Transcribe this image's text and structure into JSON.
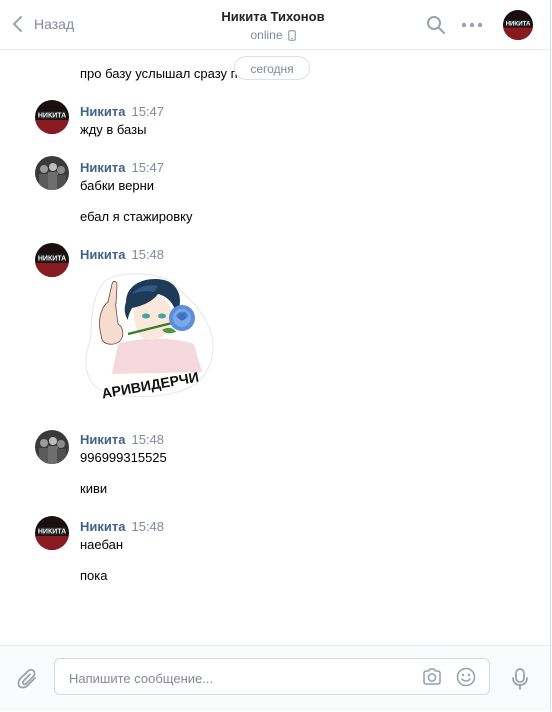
{
  "header": {
    "back_label": "Назад",
    "peer_name": "Никита Тихонов",
    "peer_status": "online",
    "icons": [
      "chevron-left-icon",
      "search-icon",
      "more-icon",
      "avatar"
    ]
  },
  "avatar_text": "НИКИТА",
  "date_separator": "сегодня",
  "messages": [
    {
      "text": "про базу услышал сразу п"
    },
    {
      "author": "Никита",
      "time": "15:47",
      "text": "жду в базы"
    },
    {
      "author": "Никита",
      "time": "15:47",
      "text": "бабки верни"
    },
    {
      "text": "ебал я стажировку"
    },
    {
      "author": "Никита",
      "time": "15:48",
      "sticker_caption": "АРИВИДЕРЧИ"
    },
    {
      "author": "Никита",
      "time": "15:48",
      "text": "996999315525"
    },
    {
      "text": "киви"
    },
    {
      "author": "Никита",
      "time": "15:48",
      "text": "наебан"
    },
    {
      "text": "пока"
    }
  ],
  "composer": {
    "placeholder": "Напишите сообщение...",
    "icons": [
      "paperclip-icon",
      "camera-icon",
      "smile-icon",
      "microphone-icon"
    ]
  },
  "colors": {
    "accent": "#42648b",
    "muted": "#828a99",
    "divider": "#e7e8ec"
  }
}
